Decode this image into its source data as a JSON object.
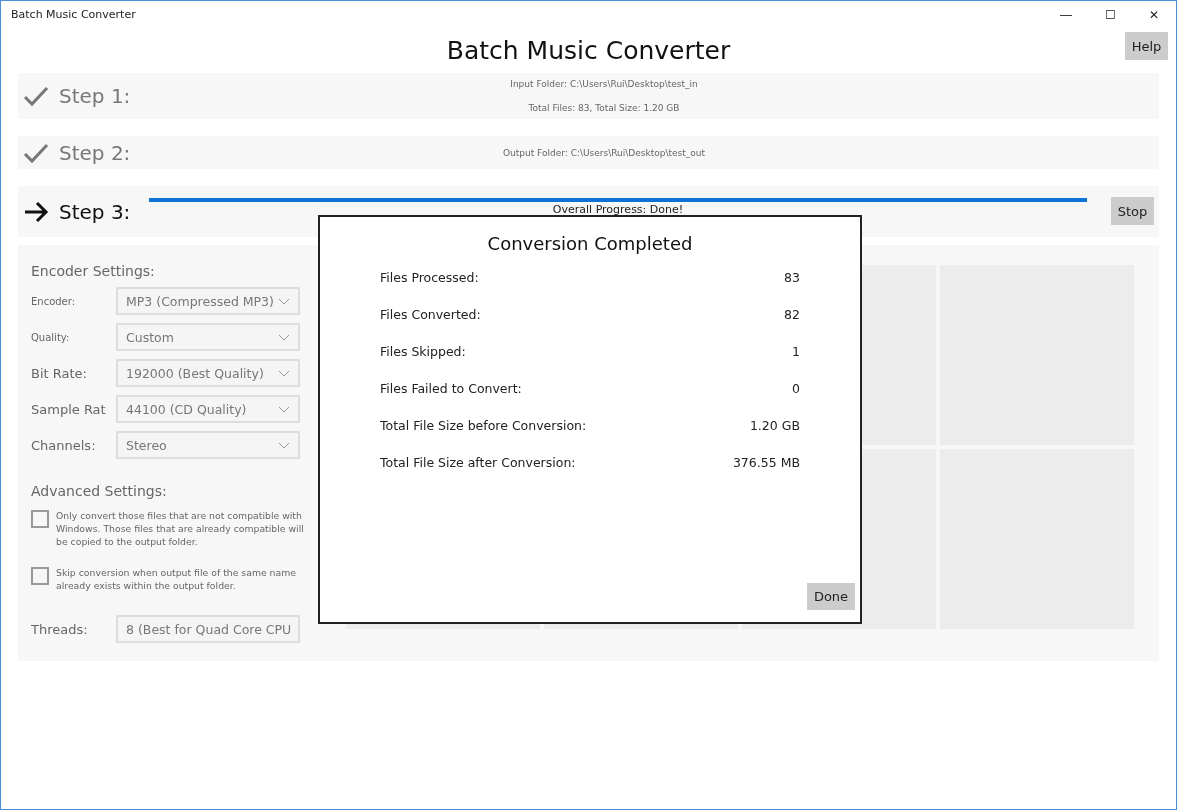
{
  "window": {
    "title": "Batch Music Converter",
    "controls": [
      "—",
      "☐",
      "✕"
    ]
  },
  "app_title": "Batch Music Converter",
  "help_button": "Help",
  "steps": [
    {
      "label": "Step 1:",
      "kind": "done",
      "lines": [
        "Input Folder: C:\\Users\\Rui\\Desktop\\test_in",
        "Total Files: 83, Total Size: 1.20 GB"
      ]
    },
    {
      "label": "Step 2:",
      "kind": "done",
      "lines": [
        "Output Folder: C:\\Users\\Rui\\Desktop\\test_out"
      ]
    },
    {
      "label": "Step 3:",
      "kind": "current",
      "progress": {
        "level": 1,
        "text": "Overall Progress:  Done!"
      },
      "button": "Stop"
    }
  ],
  "encoder_settings": {
    "title": "Encoder Settings:",
    "fields": [
      {
        "label": "Encoder:",
        "value": "MP3 (Compressed MP3)",
        "small": true
      },
      {
        "label": "Quality:",
        "value": "Custom",
        "small": true
      },
      {
        "label": "Bit Rate:",
        "value": "192000 (Best Quality)",
        "small": false
      },
      {
        "label": "Sample Rat",
        "value": "44100 (CD Quality)",
        "small": false
      },
      {
        "label": "Channels:",
        "value": "Stereo",
        "small": false
      }
    ]
  },
  "advanced_settings": {
    "title": "Advanced Settings:",
    "options": [
      {
        "text": "Only convert those files that are not compatible with Windows.  Those files that are already compatible will be copied to the output folder.",
        "checked": false
      },
      {
        "text": "Skip conversion when output file of the same name already exists within the output folder.",
        "checked": false
      }
    ],
    "threads": {
      "label": "Threads:",
      "value": "8 (Best for Quad Core CPU"
    }
  },
  "dialog": {
    "title": "Conversion Completed",
    "rows": [
      {
        "label": "Files Processed:",
        "value": "83"
      },
      {
        "label": "Files Converted:",
        "value": "82"
      },
      {
        "label": "Files Skipped:",
        "value": "1"
      },
      {
        "label": "Files Failed to Convert:",
        "value": "0"
      },
      {
        "label": "Total File Size before Conversion:",
        "value": "1.20 GB"
      },
      {
        "label": "Total File Size after Conversion:",
        "value": "376.55 MB"
      }
    ],
    "button": "Done"
  }
}
